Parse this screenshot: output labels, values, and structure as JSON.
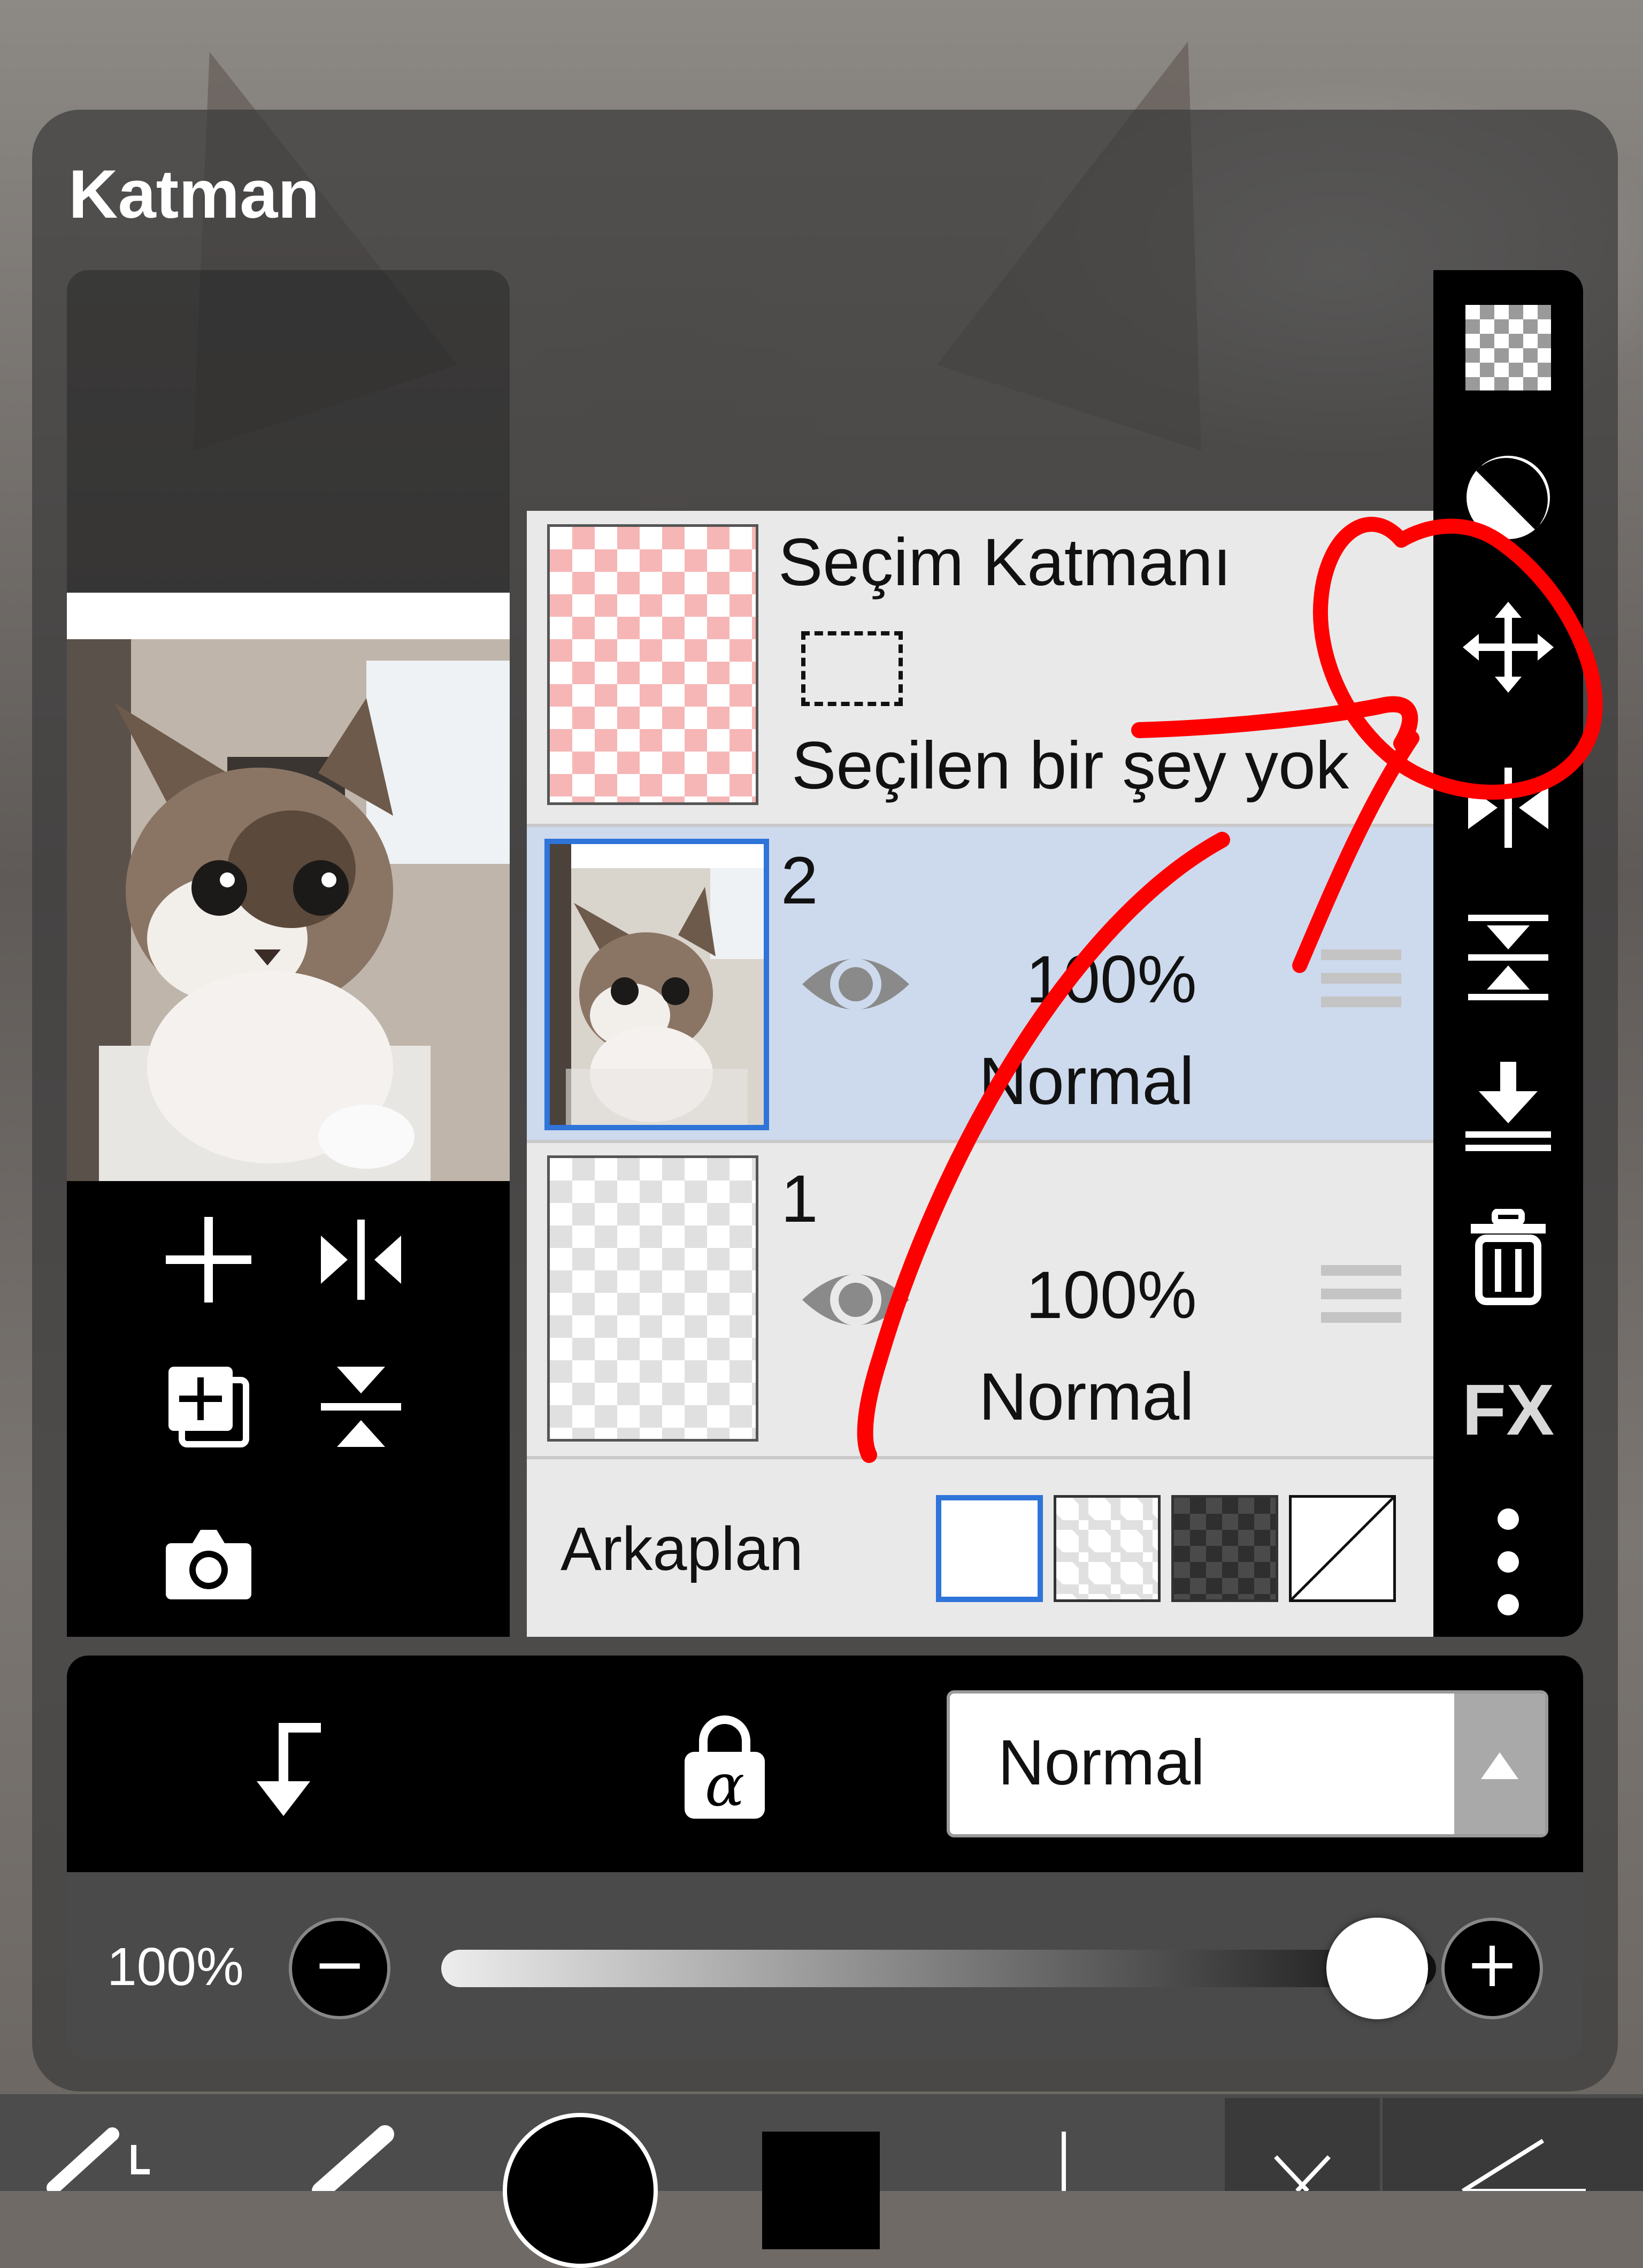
{
  "panel": {
    "title": "Katman"
  },
  "canvas_tools": {
    "add_icon": "plus-icon",
    "flip_h_icon": "flip-horizontal-icon",
    "duplicate_icon": "duplicate-layer-icon",
    "flip_v_icon": "flip-vertical-icon",
    "camera_icon": "camera-icon"
  },
  "layers": {
    "selection": {
      "title": "Seçim Katmanı",
      "status": "Seçilen bir şey yok"
    },
    "items": [
      {
        "name": "2",
        "opacity": "100%",
        "blend": "Normal",
        "selected": true
      },
      {
        "name": "1",
        "opacity": "100%",
        "blend": "Normal",
        "selected": false
      }
    ],
    "background": {
      "label": "Arkaplan"
    }
  },
  "right_strip": {
    "icons": [
      "transparency-icon",
      "invert-mask-icon",
      "move-icon",
      "flip-horizontal-icon",
      "flip-vertical-icon",
      "merge-down-icon",
      "trash-icon",
      "fx-icon",
      "more-icon"
    ],
    "fx_label": "FX"
  },
  "blend_bar": {
    "clip_icon": "clip-arrow-icon",
    "alpha_lock_icon": "alpha-lock-icon",
    "alpha_symbol": "α",
    "blend_mode": "Normal"
  },
  "opacity_bar": {
    "value_label": "100%",
    "value": 100,
    "minus": "−",
    "plus": "+"
  },
  "colors": {
    "selected_row": "#cdd9ec",
    "selection_blue": "#2f74d9",
    "annotation_red": "#ff0000"
  }
}
